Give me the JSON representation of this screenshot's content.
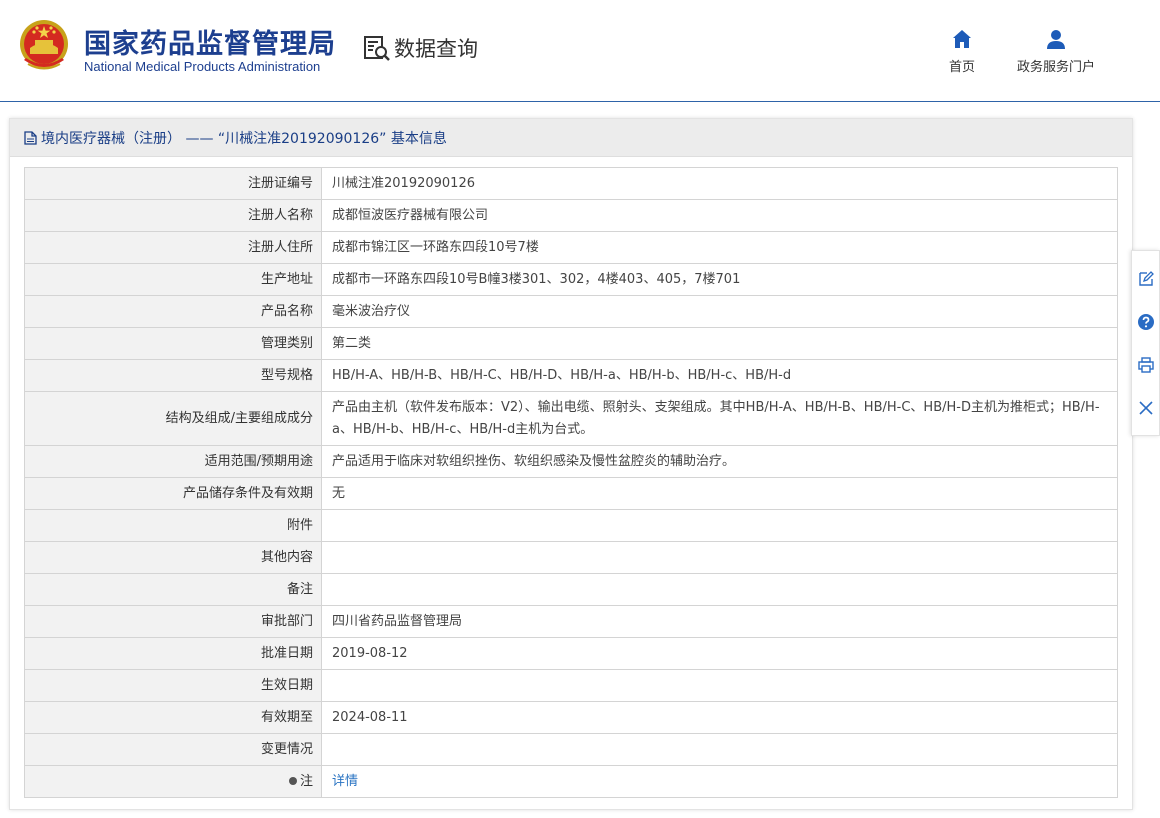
{
  "header": {
    "org_name_cn": "国家药品监督管理局",
    "org_name_en": "National Medical Products Administration",
    "query_title": "数据查询",
    "nav": [
      {
        "label": "首页",
        "icon": "home-icon"
      },
      {
        "label": "政务服务门户",
        "icon": "user-icon"
      }
    ]
  },
  "panel": {
    "title": "境内医疗器械（注册） —— “川械注准20192090126” 基本信息"
  },
  "fields": [
    {
      "label": "注册证编号",
      "value": "川械注准20192090126"
    },
    {
      "label": "注册人名称",
      "value": "成都恒波医疗器械有限公司"
    },
    {
      "label": "注册人住所",
      "value": "成都市锦江区一环路东四段10号7楼"
    },
    {
      "label": "生产地址",
      "value": "成都市一环路东四段10号B幢3楼301、302，4楼403、405，7楼701"
    },
    {
      "label": "产品名称",
      "value": "毫米波治疗仪"
    },
    {
      "label": "管理类别",
      "value": "第二类"
    },
    {
      "label": "型号规格",
      "value": "HB/H-A、HB/H-B、HB/H-C、HB/H-D、HB/H-a、HB/H-b、HB/H-c、HB/H-d"
    },
    {
      "label": "结构及组成/主要组成成分",
      "value": "产品由主机（软件发布版本：V2）、输出电缆、照射头、支架组成。其中HB/H-A、HB/H-B、HB/H-C、HB/H-D主机为推柜式；HB/H-a、HB/H-b、HB/H-c、HB/H-d主机为台式。"
    },
    {
      "label": "适用范围/预期用途",
      "value": "产品适用于临床对软组织挫伤、软组织感染及慢性盆腔炎的辅助治疗。"
    },
    {
      "label": "产品储存条件及有效期",
      "value": "无"
    },
    {
      "label": "附件",
      "value": ""
    },
    {
      "label": "其他内容",
      "value": ""
    },
    {
      "label": "备注",
      "value": ""
    },
    {
      "label": "审批部门",
      "value": "四川省药品监督管理局"
    },
    {
      "label": "批准日期",
      "value": "2019-08-12"
    },
    {
      "label": "生效日期",
      "value": ""
    },
    {
      "label": "有效期至",
      "value": "2024-08-11"
    },
    {
      "label": "变更情况",
      "value": ""
    }
  ],
  "note": {
    "label": "注",
    "link_text": "详情"
  },
  "sidebar": {
    "icons": [
      "edit-icon",
      "help-icon",
      "print-icon",
      "close-icon"
    ]
  },
  "colors": {
    "brand": "#1d3f8f",
    "link": "#2a74c3",
    "header_rule": "#2e63a8"
  }
}
